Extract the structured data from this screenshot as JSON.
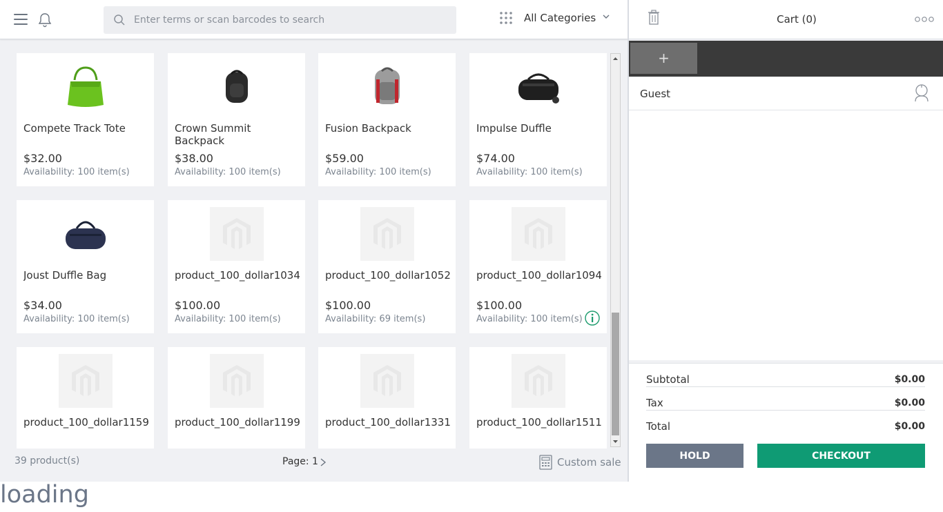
{
  "header": {
    "search_placeholder": "Enter terms or scan barcodes to search",
    "category_label": "All Categories"
  },
  "products": [
    {
      "name": "Compete Track Tote",
      "price": "$32.00",
      "availability": "Availability: 100 item(s)",
      "image": "green-tote"
    },
    {
      "name": "Crown Summit Backpack",
      "price": "$38.00",
      "availability": "Availability: 100 item(s)",
      "image": "black-backpack"
    },
    {
      "name": "Fusion Backpack",
      "price": "$59.00",
      "availability": "Availability: 100 item(s)",
      "image": "grey-red-backpack"
    },
    {
      "name": "Impulse Duffle",
      "price": "$74.00",
      "availability": "Availability: 100 item(s)",
      "image": "black-duffle"
    },
    {
      "name": "Joust Duffle Bag",
      "price": "$34.00",
      "availability": "Availability: 100 item(s)",
      "image": "navy-duffle"
    },
    {
      "name": "product_100_dollar1034",
      "price": "$100.00",
      "availability": "Availability: 100 item(s)",
      "image": "placeholder"
    },
    {
      "name": "product_100_dollar1052",
      "price": "$100.00",
      "availability": "Availability: 69 item(s)",
      "image": "placeholder"
    },
    {
      "name": "product_100_dollar1094",
      "price": "$100.00",
      "availability": "Availability: 100 item(s)",
      "image": "placeholder"
    },
    {
      "name": "product_100_dollar1159",
      "price": "",
      "availability": "",
      "image": "placeholder"
    },
    {
      "name": "product_100_dollar1199",
      "price": "",
      "availability": "",
      "image": "placeholder"
    },
    {
      "name": "product_100_dollar1331",
      "price": "",
      "availability": "",
      "image": "placeholder"
    },
    {
      "name": "product_100_dollar1511",
      "price": "",
      "availability": "",
      "image": "placeholder"
    }
  ],
  "footer": {
    "product_count": "39 product(s)",
    "page_label": "Page: 1",
    "custom_sale_label": "Custom sale"
  },
  "cart": {
    "title": "Cart (0)",
    "add_tab_label": "+",
    "customer_label": "Guest",
    "subtotal_label": "Subtotal",
    "subtotal_value": "$0.00",
    "tax_label": "Tax",
    "tax_value": "$0.00",
    "total_label": "Total",
    "total_value": "$0.00",
    "hold_label": "HOLD",
    "checkout_label": "CHECKOUT"
  },
  "status_text": "loading",
  "colors": {
    "accent": "#0f9b74",
    "hold": "#6b7688",
    "info": "#1b9a6c"
  }
}
